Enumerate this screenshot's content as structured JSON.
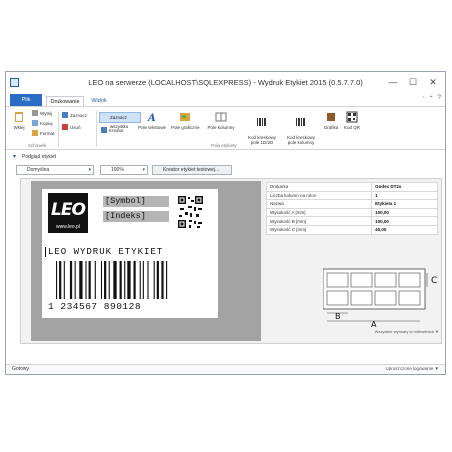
{
  "window": {
    "title": "LEO na serwerze (LOCALHOST\\SQLEXPRESS) - Wydruk Etykiet 2015 (0.5.7.7.0)",
    "controls": [
      "—",
      "☐",
      "✕"
    ]
  },
  "tabs": [
    {
      "label": "Plik"
    },
    {
      "label": "Drukowanie"
    },
    {
      "label": "Widok"
    }
  ],
  "ribbon": {
    "right_icons": [
      "◦",
      "⌃",
      "?"
    ],
    "clipboard": {
      "paste": "Wklej",
      "cut": "Wytnij",
      "copy": "Kopiuj",
      "format": "Format",
      "group": "Schowek"
    },
    "edit": {
      "select": "Zaznacz",
      "delete": "Usuń",
      "wizard": "Kreator"
    },
    "fields": {
      "select_all": "Zaznacz wszystko",
      "text": "Pole tekstowe",
      "graphic": "Pole graficzne",
      "column": "Pole kolumny",
      "barcode": "Kod kreskowy\npole 1D/2D",
      "barcode2": "Kod kreskowy\npole kolumny",
      "grafika": "Grafika",
      "qr": "Kod QR",
      "group": "Pola etykiety"
    }
  },
  "panel": {
    "header": "Podgląd etykiet",
    "printer_combo": "Domyślna",
    "zoom_combo": "100%",
    "third_combo": "Kreator etykiet testowej..."
  },
  "label": {
    "logo": "LEO",
    "url": "www.leo.pl",
    "field1": "[Symbol]",
    "field2": "[Indeks]",
    "title": "LEO WYDRUK ETYKIET",
    "barcode_number": "1 234567 890128"
  },
  "info_table": [
    {
      "k": "Drukarka",
      "v": "Godex DT2x"
    },
    {
      "k": "Liczba kolumn na rolce",
      "v": "1"
    },
    {
      "k": "Nazwa",
      "v": "Etykieta 1"
    },
    {
      "k": "Wysokość A [mm]",
      "v": "100,00"
    },
    {
      "k": "Wysokość B [mm]",
      "v": "100,00"
    },
    {
      "k": "Wysokość C [mm]",
      "v": "40,00"
    }
  ],
  "dims": {
    "a": "A",
    "b": "B",
    "c": "C",
    "caption": "Wszystkie wymiary w milimetrach ▼"
  },
  "status": {
    "left": "Gotowy",
    "right": "Uproszczone logowanie ▼"
  }
}
